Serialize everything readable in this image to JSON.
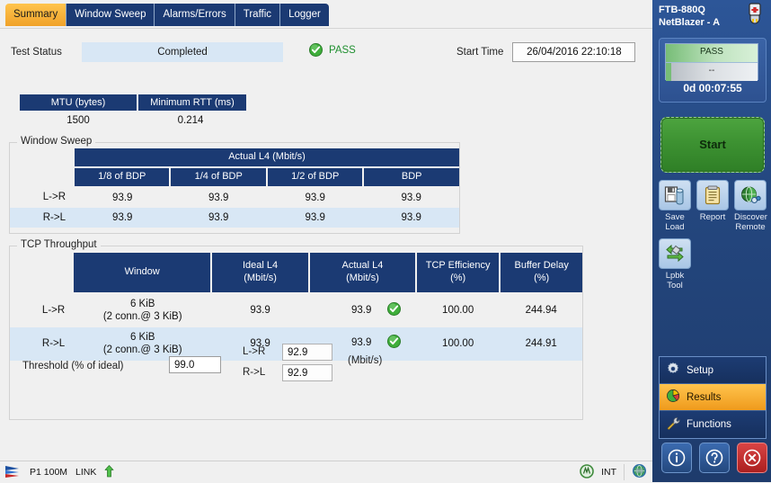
{
  "tabs": [
    {
      "label": "Summary",
      "active": true
    },
    {
      "label": "Window Sweep",
      "active": false
    },
    {
      "label": "Alarms/Errors",
      "active": false
    },
    {
      "label": "Traffic",
      "active": false
    },
    {
      "label": "Logger",
      "active": false
    }
  ],
  "status_row": {
    "test_status_label": "Test Status",
    "test_status_value": "Completed",
    "verdict": "PASS",
    "verdict_color": "#1f8f2f",
    "start_time_label": "Start Time",
    "start_time_value": "26/04/2016 22:10:18"
  },
  "mtu_rtt": {
    "mtu_header": "MTU (bytes)",
    "rtt_header": "Minimum RTT (ms)",
    "mtu_value": "1500",
    "rtt_value": "0.214"
  },
  "window_sweep": {
    "group_label": "Window Sweep",
    "super_header": "Actual L4 (Mbit/s)",
    "columns": [
      "1/8 of BDP",
      "1/4 of BDP",
      "1/2 of BDP",
      "BDP"
    ],
    "rows": [
      {
        "direction": "L->R",
        "values": [
          "93.9",
          "93.9",
          "93.9",
          "93.9"
        ]
      },
      {
        "direction": "R->L",
        "values": [
          "93.9",
          "93.9",
          "93.9",
          "93.9"
        ]
      }
    ]
  },
  "tcp_throughput": {
    "group_label": "TCP Throughput",
    "columns": [
      {
        "line1": "Window",
        "line2": ""
      },
      {
        "line1": "Ideal L4",
        "line2": "(Mbit/s)"
      },
      {
        "line1": "Actual L4",
        "line2": "(Mbit/s)"
      },
      {
        "line1": "TCP Efficiency",
        "line2": "(%)"
      },
      {
        "line1": "Buffer Delay",
        "line2": "(%)"
      }
    ],
    "rows": [
      {
        "direction": "L->R",
        "window_line1": "6 KiB",
        "window_line2": "(2 conn.@ 3 KiB)",
        "ideal_l4": "93.9",
        "actual_l4": "93.9",
        "actual_l4_status": "pass",
        "tcp_efficiency": "100.00",
        "buffer_delay": "244.94"
      },
      {
        "direction": "R->L",
        "window_line1": "6 KiB",
        "window_line2": "(2 conn.@ 3 KiB)",
        "ideal_l4": "93.9",
        "actual_l4": "93.9",
        "actual_l4_status": "pass",
        "tcp_efficiency": "100.00",
        "buffer_delay": "244.91"
      }
    ],
    "threshold": {
      "label": "Threshold (% of ideal)",
      "value": "99.0",
      "lr_label": "L->R",
      "lr_value": "92.9",
      "rl_label": "R->L",
      "rl_value": "92.9",
      "unit": "(Mbit/s)"
    }
  },
  "status_bar": {
    "port": "P1 100M",
    "link_label": "LINK",
    "link_icon": "up-arrow-icon",
    "int_label": "INT",
    "left_icon": "signal-icon",
    "right_icon": "globe-icon"
  },
  "right_panel": {
    "title_line1": "FTB-880Q",
    "title_line2": "NetBlazer  - A",
    "battery_icon": "battery-plug-icon",
    "gauge_top_text": "PASS",
    "gauge_bottom_text": "--",
    "timer": "0d 00:07:55",
    "start_button": "Start",
    "icons": [
      {
        "name": "save-load",
        "caption_line1": "Save",
        "caption_line2": "Load",
        "icon": "floppy-disk-icon"
      },
      {
        "name": "report",
        "caption_line1": "Report",
        "caption_line2": "",
        "icon": "clipboard-icon"
      },
      {
        "name": "discover-remote",
        "caption_line1": "Discover",
        "caption_line2": "Remote",
        "icon": "globe-search-icon"
      },
      {
        "name": "lpbk-tool",
        "caption_line1": "Lpbk",
        "caption_line2": "Tool",
        "icon": "loopback-wrench-icon"
      }
    ],
    "nav": [
      {
        "label": "Setup",
        "icon": "gear-icon",
        "active": false
      },
      {
        "label": "Results",
        "icon": "pie-chart-icon",
        "active": true
      },
      {
        "label": "Functions",
        "icon": "tools-icon",
        "active": false
      }
    ],
    "bottom_buttons": [
      {
        "name": "info-button",
        "glyph": "i",
        "style": "blue"
      },
      {
        "name": "help-button",
        "glyph": "?",
        "style": "blue"
      },
      {
        "name": "close-button",
        "glyph": "x",
        "style": "red"
      }
    ]
  },
  "colors": {
    "header_blue": "#1b3a73",
    "accent_orange": "#f0a22a",
    "alt_row": "#d8e7f5",
    "pass_green": "#3fae3b",
    "panel_blue": "#24477f"
  }
}
